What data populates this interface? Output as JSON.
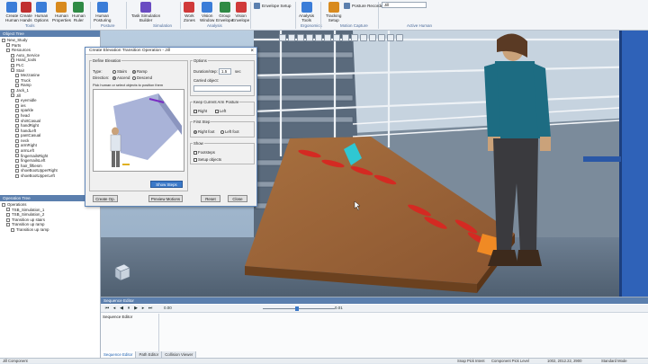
{
  "ribbon": {
    "buttons": [
      {
        "label": "Create\nHuman",
        "icon": "human-create-icon",
        "color": "#3b7dd8"
      },
      {
        "label": "Create\nHands",
        "icon": "hands-icon",
        "color": "#c03030"
      },
      {
        "label": "Human\nOptions",
        "icon": "human-options-icon",
        "color": "#3b7dd8"
      },
      {
        "label": "Human\nProperties",
        "icon": "properties-icon",
        "color": "#d88a1e"
      },
      {
        "label": "Human\nRuler",
        "icon": "ruler-icon",
        "color": "#2f8a45"
      },
      {
        "label": "Human\nPosturing",
        "icon": "posturing-icon",
        "color": "#3b7dd8"
      },
      {
        "label": "Task Simulation\nBuilder",
        "icon": "task-builder-icon",
        "color": "#6a4cc2"
      },
      {
        "label": "Work\nZones",
        "icon": "work-zones-icon",
        "color": "#d03a3a"
      },
      {
        "label": "Vision\nWindow",
        "icon": "vision-window-icon",
        "color": "#3b7dd8"
      },
      {
        "label": "Group\nEnvelope",
        "icon": "group-envelope-icon",
        "color": "#2f8a45"
      },
      {
        "label": "Vision\nEnvelope",
        "icon": "vision-envelope-icon",
        "color": "#d03a3a"
      },
      {
        "label": "Analysis\nTools",
        "icon": "analysis-tools-icon",
        "color": "#3b7dd8"
      },
      {
        "label": "Tracking\nSetup",
        "icon": "tracking-setup-icon",
        "color": "#d88a1e"
      }
    ],
    "groups": [
      "Tools",
      "Posture",
      "Simulation",
      "Analysis",
      "Ergonomics",
      "Motion Capture",
      "Active Human"
    ],
    "envelope_setup": "Envelope Setup",
    "posture_recorder": "Posture Recorder",
    "active_human_value": "Jill"
  },
  "object_tree": {
    "title": "Object Tree",
    "items": [
      {
        "label": "New_Study",
        "indent": 0
      },
      {
        "label": "Parts",
        "indent": 1
      },
      {
        "label": "Resources",
        "indent": 1
      },
      {
        "label": "Auto_Service",
        "indent": 2
      },
      {
        "label": "Hand_tools",
        "indent": 2
      },
      {
        "label": "PLC",
        "indent": 2
      },
      {
        "label": "Stair",
        "indent": 2
      },
      {
        "label": "Mezzanine",
        "indent": 3
      },
      {
        "label": "Truck",
        "indent": 3
      },
      {
        "label": "Ramp",
        "indent": 3
      },
      {
        "label": "Jack_1",
        "indent": 2
      },
      {
        "label": "Jill",
        "indent": 2
      },
      {
        "label": "eyemidle",
        "indent": 3
      },
      {
        "label": "ies",
        "indent": 3
      },
      {
        "label": "sparkle",
        "indent": 3
      },
      {
        "label": "head",
        "indent": 3
      },
      {
        "label": "shirtCasual",
        "indent": 3
      },
      {
        "label": "handRight",
        "indent": 3
      },
      {
        "label": "handLeft",
        "indent": 3
      },
      {
        "label": "pantCasual",
        "indent": 3
      },
      {
        "label": "neck",
        "indent": 3
      },
      {
        "label": "armRight",
        "indent": 3
      },
      {
        "label": "armLeft",
        "indent": 3
      },
      {
        "label": "fingernailsRight",
        "indent": 3
      },
      {
        "label": "fingernailsLeft",
        "indent": 3
      },
      {
        "label": "hair_fiftiesm",
        "indent": 3
      },
      {
        "label": "shoeBootUpperRight",
        "indent": 3
      },
      {
        "label": "shoeBootUpperLeft",
        "indent": 3
      }
    ]
  },
  "operation_tree": {
    "title": "Operation Tree",
    "items": [
      {
        "label": "Operations",
        "indent": 0
      },
      {
        "label": "TSB_Simulation_1",
        "indent": 1
      },
      {
        "label": "TSB_Simulation_2",
        "indent": 1
      },
      {
        "label": "Transition up stairs",
        "indent": 1
      },
      {
        "label": "Transition up ramp",
        "indent": 1
      },
      {
        "label": "Transition up ramp",
        "indent": 2
      }
    ]
  },
  "dialog": {
    "title": "Create Elevation Transition Operation - Jill",
    "define_elevation_legend": "Define Elevation",
    "type_label": "Type:",
    "type_options": [
      "Stairs",
      "Ramp"
    ],
    "type_selected": "Ramp",
    "direction_label": "Direction:",
    "direction_options": [
      "Ascend",
      "Descend"
    ],
    "direction_selected": "Ascend",
    "pick_hint": "Pick human or select objects to position them",
    "show_steps": "Show Steps",
    "options_legend": "Options",
    "duration_label": "Duration/step:",
    "duration_value": "1.5",
    "duration_unit": "sec",
    "carried_label": "Carried object:",
    "keep_posture_legend": "Keep Current Arm Posture",
    "keep_right": "Right",
    "keep_left": "Left",
    "first_step_legend": "First Step",
    "first_step_options": [
      "Right foot",
      "Left foot"
    ],
    "first_step_selected": "Right foot",
    "show_legend": "Show",
    "show_footsteps": "Footsteps",
    "show_setup_objects": "Setup objects",
    "create_op": "Create Op.",
    "preview_motions": "Preview Motions",
    "reset": "Reset",
    "close": "Close"
  },
  "sequence_editor": {
    "title": "Sequence Editor",
    "label": "Sequence Editor",
    "time_start": "0.00",
    "time_current": "0.01"
  },
  "tabs": [
    "Sequence Editor",
    "Path Editor",
    "Collision Viewer"
  ],
  "status": {
    "left": "Jill Component",
    "pick_intent": "Snap Pick Intent",
    "pick_level": "Component Pick Level",
    "coords": "1002, 2012.22, 2900",
    "mode": "Standard Mode"
  },
  "colors": {
    "accent": "#5b7fae",
    "ramp": "#a86a3a",
    "footprint": "#d42a22",
    "girder": "#2f62b8",
    "dialog_button": "#3a78c8"
  }
}
